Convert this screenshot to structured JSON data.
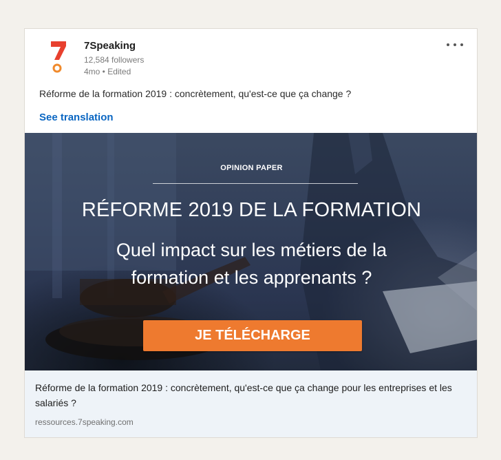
{
  "post": {
    "author": {
      "name": "7Speaking",
      "logo_digit": "7",
      "followers": "12,584 followers",
      "meta": "4mo • Edited"
    },
    "text": "Réforme de la formation 2019 : concrètement, qu'est-ce que ça change ?",
    "see_translation_label": "See translation"
  },
  "banner": {
    "label": "OPINION PAPER",
    "title": "RÉFORME 2019 DE LA FORMATION",
    "subtitle_line1": "Quel impact sur les métiers de la",
    "subtitle_line2": "formation  et les apprenants ?",
    "cta_label": "JE TÉLÉCHARGE"
  },
  "link_preview": {
    "title": "Réforme de la formation 2019 : concrètement, qu'est-ce que ça change pour les entreprises et les salariés ?",
    "domain": "ressources.7speaking.com"
  },
  "colors": {
    "brand_red": "#e8402e",
    "brand_orange": "#f08a2c",
    "cta_orange": "#ee7a2f",
    "link_blue": "#0a66c2",
    "banner_navy": "#2f3b55"
  },
  "icons": {
    "more": "more-horizontal-icon"
  }
}
